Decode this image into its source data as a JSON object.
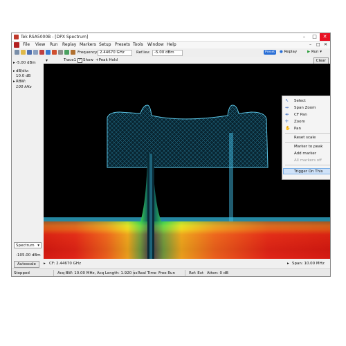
{
  "window": {
    "title": "Tek RSA5000B - [DPX Spectrum]",
    "controls": [
      "–",
      "□",
      "✕"
    ]
  },
  "menu": {
    "items": [
      "File",
      "View",
      "Run",
      "Replay",
      "Markers",
      "Setup",
      "Presets",
      "Tools",
      "Window",
      "Help"
    ],
    "mdi_controls": [
      "–",
      "□",
      "✕"
    ]
  },
  "toolbar": {
    "frequency_label": "Frequency:",
    "frequency_value": "2.44670 GHz",
    "ref_level_label": "Ref.lev:",
    "ref_level_value": "-5.00 dBm",
    "preset_label": "Preset",
    "replay_label": "Replay",
    "run_label": "Run"
  },
  "left_panel": {
    "ref_value": "-5.00 dBm",
    "db_div_label": "dB/div:",
    "db_div_value": "10.0 dB",
    "rbw_label": "RBW:",
    "rbw_value": "100 kHz",
    "view_select": "Spectrum",
    "bottom_value": "-105.00 dBm",
    "autoscale_label": "Autoscale"
  },
  "trace": {
    "name": "Trace1",
    "show_label": "Show",
    "show_checked": true,
    "detection": "+Peak Hold",
    "clear_label": "Clear"
  },
  "context_menu": {
    "items": [
      {
        "label": "Select",
        "icon": "pointer-icon"
      },
      {
        "label": "Span Zoom",
        "icon": "span-zoom-icon"
      },
      {
        "label": "CF Pan",
        "icon": "cf-pan-icon"
      },
      {
        "label": "Zoom",
        "icon": "zoom-icon"
      },
      {
        "label": "Pan",
        "icon": "hand-icon"
      },
      {
        "label": "Reset scale"
      },
      {
        "label": "Marker to peak"
      },
      {
        "label": "Add marker"
      },
      {
        "label": "All markers off",
        "disabled": true
      },
      {
        "label": "Trigger On This",
        "highlighted": true
      }
    ]
  },
  "bottom_bar": {
    "cf": "CF: 2.44670 GHz",
    "span": "Span: 10.00 MHz"
  },
  "status": {
    "state": "Stopped",
    "acq": "Acq BW: 10.00 MHz, Acq Length: 1.920 us",
    "mode": "Real Time",
    "run": "Free Run",
    "ref": "Ref: Ext",
    "atten": "Atten: 0 dB"
  },
  "colors": {
    "plot_bg": "#000000",
    "trace_cyan": "#49c8f0",
    "heat_red": "#e0201a",
    "heat_yellow": "#f0e020",
    "heat_green": "#3ad050",
    "accent_blue": "#2a6fd6"
  }
}
